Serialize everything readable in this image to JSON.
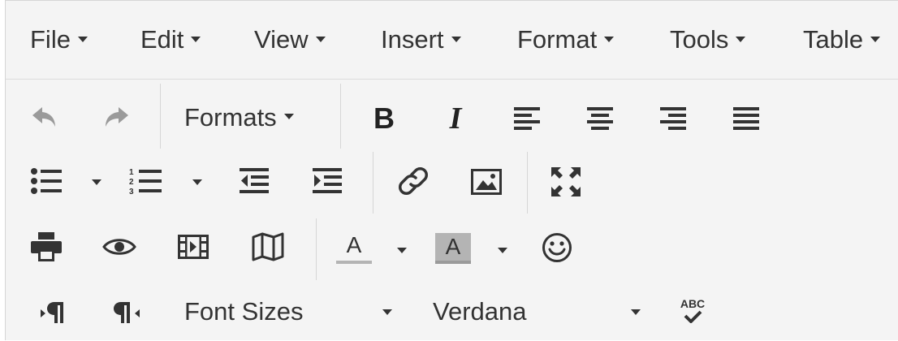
{
  "menubar": {
    "items": [
      {
        "label": "File"
      },
      {
        "label": "Edit"
      },
      {
        "label": "View"
      },
      {
        "label": "Insert"
      },
      {
        "label": "Format"
      },
      {
        "label": "Tools"
      },
      {
        "label": "Table"
      }
    ]
  },
  "toolbar": {
    "formats_label": "Formats",
    "bold_glyph": "B",
    "italic_glyph": "I",
    "font_sizes_label": "Font Sizes",
    "font_family_label": "Verdana",
    "spellcheck_glyph": "ABC",
    "text_color_glyph": "A",
    "bg_color_glyph": "A",
    "rtl_glyph": "¶",
    "ltr_glyph": "¶",
    "bg_color_swatch": "#b4b4b4",
    "icon_color": "#333333",
    "disabled_icon_color": "#9a9a9a"
  }
}
